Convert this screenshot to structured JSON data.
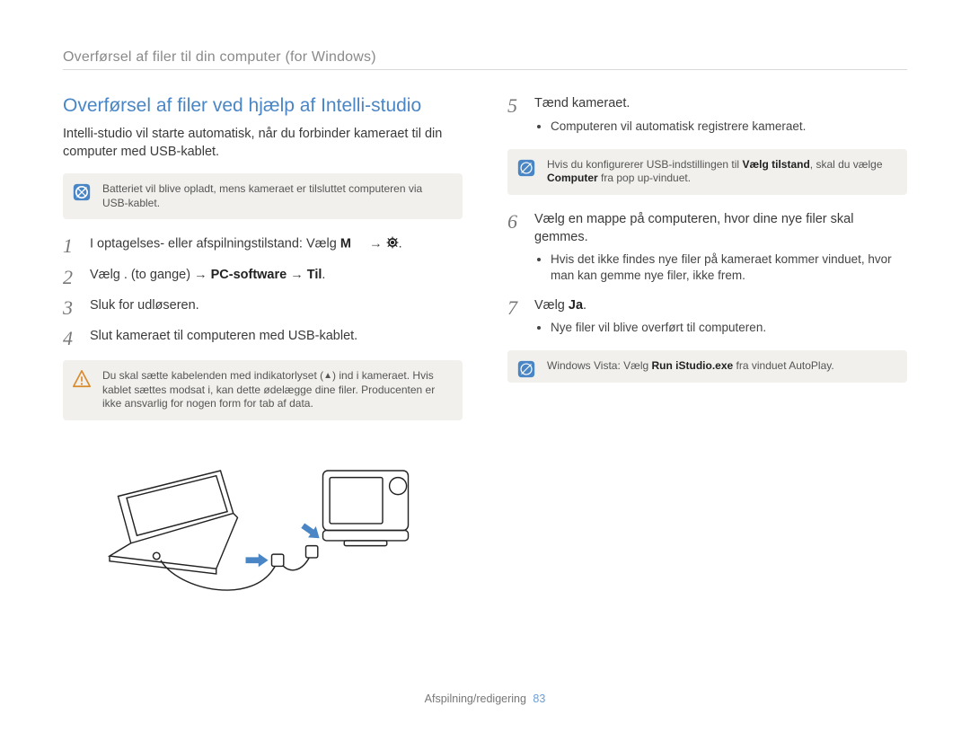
{
  "breadcrumb": "Overførsel af filer til din computer (for Windows)",
  "section_title": "Overførsel af filer ved hjælp af Intelli-studio",
  "intro": "Intelli-studio vil starte automatisk, når du forbinder kameraet til din computer med USB-kablet.",
  "note_battery": "Batteriet vil blive opladt, mens kameraet er tilsluttet computeren via USB-kablet.",
  "steps_left": {
    "1": {
      "num": "1",
      "text_pre": "I optagelses- eller afspilningstilstand: Vælg ",
      "m": "M",
      "arrow": "→",
      "dot": "."
    },
    "2": {
      "num": "2",
      "text_pre": "Vælg .     (to gange) → ",
      "bold1": "PC-software",
      "arrow": " → ",
      "bold2": "Til",
      "dot": "."
    },
    "3": {
      "num": "3",
      "text": "Sluk for udløseren."
    },
    "4": {
      "num": "4",
      "text": "Slut kameraet til computeren med USB-kablet."
    }
  },
  "note_warn": {
    "pre": "Du skal sætte kabelenden med indikatorlyset (",
    "triangle": "▲",
    "post": ") ind i kameraet. Hvis kablet sættes modsat i, kan dette ødelægge dine filer. Producenten er ikke ansvarlig for nogen form for tab af data."
  },
  "steps_right": {
    "5": {
      "num": "5",
      "text": "Tænd kameraet.",
      "sub": "Computeren vil automatisk registrere kameraet."
    },
    "note_usb": {
      "pre": "Hvis du konfigurerer USB-indstillingen til ",
      "bold1": "Vælg tilstand",
      "mid": ", skal du vælge ",
      "bold2": "Computer",
      "post": " fra pop up-vinduet."
    },
    "6": {
      "num": "6",
      "text": "Vælg en mappe på computeren, hvor dine nye filer skal gemmes.",
      "sub": "Hvis det ikke findes nye filer på kameraet kommer vinduet, hvor man kan gemme nye filer, ikke frem."
    },
    "7": {
      "num": "7",
      "text_pre": "Vælg ",
      "bold": "Ja",
      "dot": ".",
      "sub": "Nye filer vil blive overført til computeren."
    },
    "note_vista": {
      "pre": "Windows Vista: Vælg ",
      "bold": "Run iStudio.exe",
      "post": " fra vinduet AutoPlay."
    }
  },
  "footer": {
    "label": "Afspilning/redigering",
    "page": "83"
  }
}
